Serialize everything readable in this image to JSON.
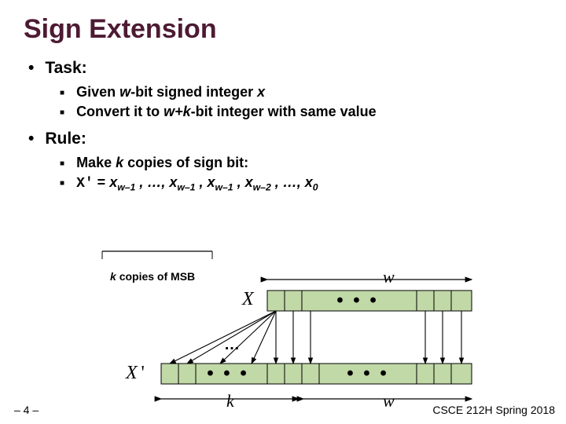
{
  "title": "Sign Extension",
  "task": {
    "heading": "Task:",
    "items": {
      "a_pre": "Given ",
      "a_w": "w",
      "a_mid": "-bit signed integer ",
      "a_x": "x",
      "b_pre": "Convert it to ",
      "b_wk": "w+k",
      "b_post": "-bit integer with same value"
    }
  },
  "rule": {
    "heading": "Rule:",
    "items": {
      "a_pre": "Make ",
      "a_k": "k",
      "a_post": " copies of sign bit:",
      "b_lhs": "X'",
      "b_eq": " = ",
      "b_rhs_html": "x_{w-1} , …, x_{w-1} , x_{w-1} , x_{w-2} , …, x_0"
    }
  },
  "diagram": {
    "k_copies_label": "k copies of MSB",
    "w_top": "w",
    "x_label": "X",
    "ellipsis": "• • •",
    "middle_ellipsis": "…",
    "xprime_label": "X'",
    "k_bottom": "k",
    "w_bottom": "w"
  },
  "footer": {
    "page": "– 4 –",
    "course": "CSCE 212H Spring 2018"
  }
}
